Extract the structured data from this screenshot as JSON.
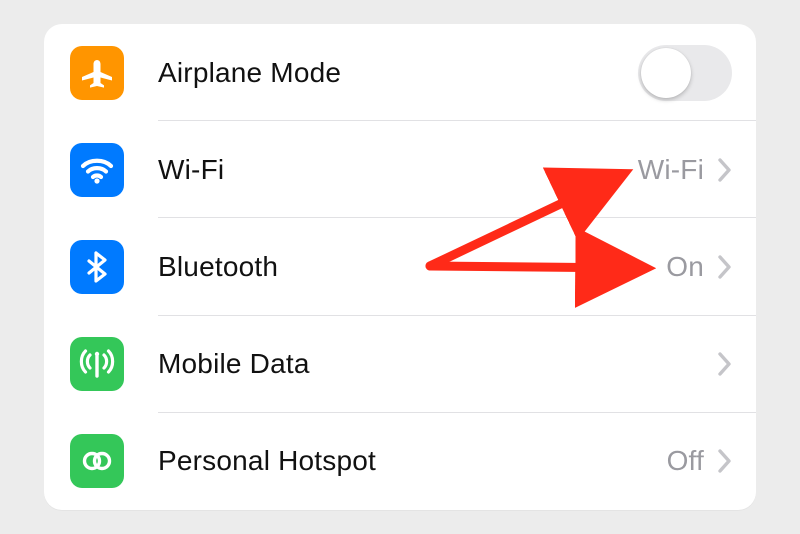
{
  "rows": [
    {
      "id": "airplane",
      "label": "Airplane Mode",
      "value": "",
      "hasChevron": false,
      "hasToggle": true,
      "toggleOn": false
    },
    {
      "id": "wifi",
      "label": "Wi-Fi",
      "value": "Wi-Fi",
      "hasChevron": true,
      "hasToggle": false
    },
    {
      "id": "bluetooth",
      "label": "Bluetooth",
      "value": "On",
      "hasChevron": true,
      "hasToggle": false
    },
    {
      "id": "mobile",
      "label": "Mobile Data",
      "value": "",
      "hasChevron": true,
      "hasToggle": false
    },
    {
      "id": "hotspot",
      "label": "Personal Hotspot",
      "value": "Off",
      "hasChevron": true,
      "hasToggle": false
    }
  ],
  "colors": {
    "orange": "#ff9500",
    "blue": "#007aff",
    "green": "#34c759",
    "annotation": "#ff3b30"
  }
}
